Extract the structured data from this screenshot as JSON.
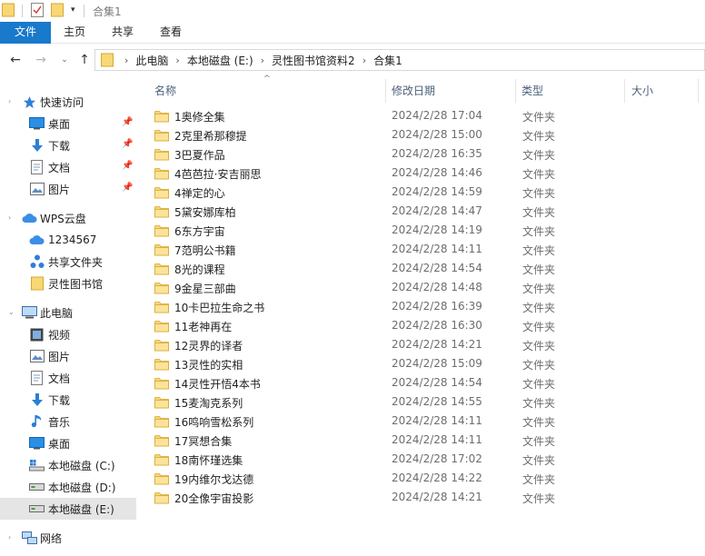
{
  "window": {
    "title": "合集1"
  },
  "ribbon": {
    "tabs": {
      "file": "文件",
      "home": "主页",
      "share": "共享",
      "view": "查看"
    }
  },
  "address": {
    "crumbs": [
      "此电脑",
      "本地磁盘 (E:)",
      "灵性图书馆资料2",
      "合集1"
    ]
  },
  "sidebar": {
    "quick_access": {
      "label": "快速访问",
      "items": [
        "桌面",
        "下载",
        "文档",
        "图片"
      ]
    },
    "wps": {
      "label": "WPS云盘",
      "items": [
        "1234567",
        "共享文件夹",
        "灵性图书馆"
      ]
    },
    "this_pc": {
      "label": "此电脑",
      "items": [
        "视频",
        "图片",
        "文档",
        "下载",
        "音乐",
        "桌面",
        "本地磁盘 (C:)",
        "本地磁盘 (D:)",
        "本地磁盘 (E:)"
      ]
    },
    "network": {
      "label": "网络"
    }
  },
  "columns": {
    "name": "名称",
    "date": "修改日期",
    "type": "类型",
    "size": "大小"
  },
  "files": [
    {
      "name": "1奥修全集",
      "date": "2024/2/28 17:04",
      "type": "文件夹"
    },
    {
      "name": "2克里希那穆提",
      "date": "2024/2/28 15:00",
      "type": "文件夹"
    },
    {
      "name": "3巴夏作品",
      "date": "2024/2/28 16:35",
      "type": "文件夹"
    },
    {
      "name": "4芭芭拉·安吉丽思",
      "date": "2024/2/28 14:46",
      "type": "文件夹"
    },
    {
      "name": "4禅定的心",
      "date": "2024/2/28 14:59",
      "type": "文件夹"
    },
    {
      "name": "5黛安娜库柏",
      "date": "2024/2/28 14:47",
      "type": "文件夹"
    },
    {
      "name": "6东方宇宙",
      "date": "2024/2/28 14:19",
      "type": "文件夹"
    },
    {
      "name": "7范明公书籍",
      "date": "2024/2/28 14:11",
      "type": "文件夹"
    },
    {
      "name": "8光的课程",
      "date": "2024/2/28 14:54",
      "type": "文件夹"
    },
    {
      "name": "9金星三部曲",
      "date": "2024/2/28 14:48",
      "type": "文件夹"
    },
    {
      "name": "10卡巴拉生命之书",
      "date": "2024/2/28 16:39",
      "type": "文件夹"
    },
    {
      "name": "11老神再在",
      "date": "2024/2/28 16:30",
      "type": "文件夹"
    },
    {
      "name": "12灵界的译者",
      "date": "2024/2/28 14:21",
      "type": "文件夹"
    },
    {
      "name": "13灵性的实相",
      "date": "2024/2/28 15:09",
      "type": "文件夹"
    },
    {
      "name": "14灵性开悟4本书",
      "date": "2024/2/28 14:54",
      "type": "文件夹"
    },
    {
      "name": "15麦淘克系列",
      "date": "2024/2/28 14:55",
      "type": "文件夹"
    },
    {
      "name": "16鸣响雪松系列",
      "date": "2024/2/28 14:11",
      "type": "文件夹"
    },
    {
      "name": "17冥想合集",
      "date": "2024/2/28 14:11",
      "type": "文件夹"
    },
    {
      "name": "18南怀瑾选集",
      "date": "2024/2/28 17:02",
      "type": "文件夹"
    },
    {
      "name": "19内维尔戈达德",
      "date": "2024/2/28 14:22",
      "type": "文件夹"
    },
    {
      "name": "20全像宇宙投影",
      "date": "2024/2/28 14:21",
      "type": "文件夹"
    }
  ]
}
